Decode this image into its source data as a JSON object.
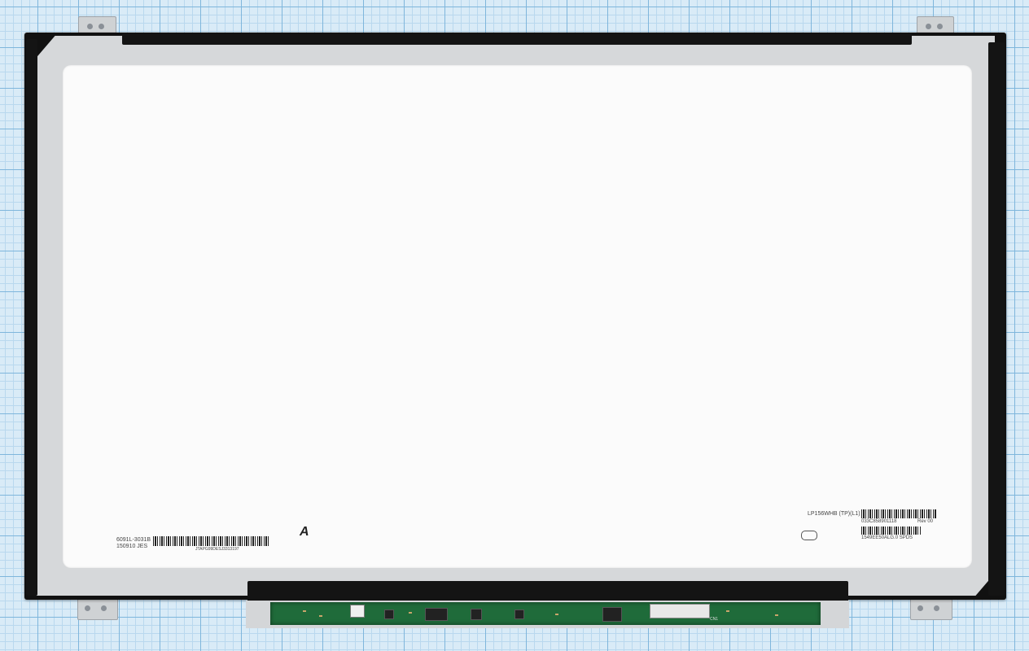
{
  "labels": {
    "left_part_number": "6091L-3031B",
    "left_date": "150910  JES",
    "left_barcode_caption": "JTAPG99DESJ3313197",
    "center_marker": "A",
    "model": "LP156WHB (TP)(L1)",
    "serial": "033C858901118",
    "rev": "Rev 00",
    "lot": "1549EE50ALG.0 SPDS",
    "connector": "CN1"
  }
}
